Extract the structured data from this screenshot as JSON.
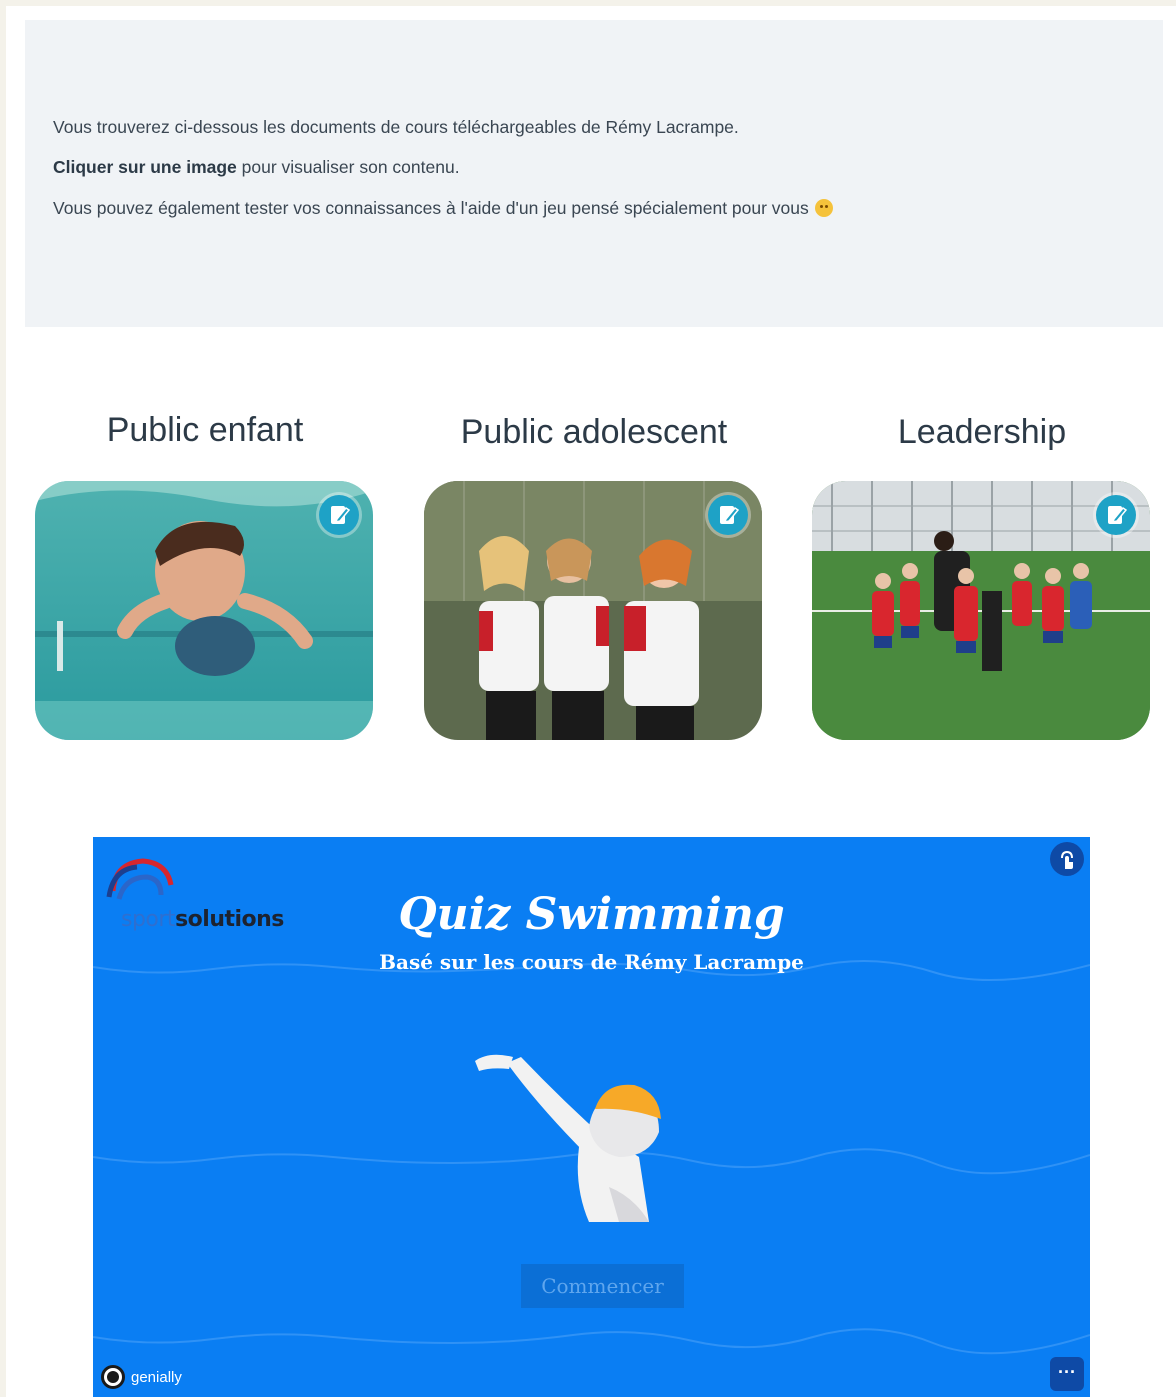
{
  "intro": {
    "line1": "Vous trouverez ci-dessous les documents de cours téléchargeables de Rémy Lacrampe.",
    "line2_bold": "Cliquer sur une image",
    "line2_rest": " pour visualiser son contenu.",
    "line3": "Vous pouvez également tester vos connaissances à l'aide d'un jeu pensé spécialement pour vous",
    "emoji": "smile-emoji"
  },
  "cards": [
    {
      "title": "Public enfant",
      "image": "child-swimming-underwater-photo",
      "badge_icon": "edit-icon"
    },
    {
      "title": "Public adolescent",
      "image": "softball-girls-high-five-photo",
      "badge_icon": "edit-icon"
    },
    {
      "title": "Leadership",
      "image": "youth-soccer-team-huddle-photo",
      "badge_icon": "edit-icon"
    }
  ],
  "quiz": {
    "logo_part1": "sport",
    "logo_part2": "solutions",
    "title": "Quiz Swimming",
    "subtitle": "Basé sur les cours de Rémy Lacrampe",
    "start_label": "Commencer",
    "more_label": "···",
    "genially_label": "genially",
    "background_color": "#0a7ef3",
    "cap_color": "#f7a928"
  }
}
